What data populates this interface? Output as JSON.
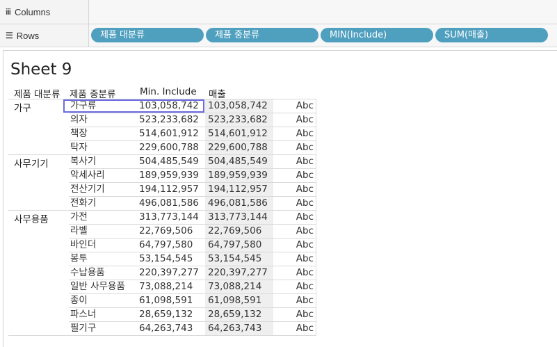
{
  "shelves": {
    "columns": {
      "label": "Columns",
      "icon": "iii"
    },
    "rows": {
      "label": "Rows",
      "icon": "☰",
      "pills": [
        "제품 대분류",
        "제품 중분류",
        "MIN(Include)",
        "SUM(매출)"
      ]
    }
  },
  "sheet": {
    "title": "Sheet 9",
    "headers": {
      "category": "제품 대분류",
      "subcategory": "제품 중분류",
      "min_include": "Min. Include",
      "sales": "매출"
    },
    "categories": [
      "가구",
      "사무기기",
      "사무용품"
    ],
    "rows": [
      {
        "sub": "가구류",
        "min": "103,058,742",
        "sales": "103,058,742",
        "abc": "Abc"
      },
      {
        "sub": "의자",
        "min": "523,233,682",
        "sales": "523,233,682",
        "abc": "Abc"
      },
      {
        "sub": "책장",
        "min": "514,601,912",
        "sales": "514,601,912",
        "abc": "Abc"
      },
      {
        "sub": "탁자",
        "min": "229,600,788",
        "sales": "229,600,788",
        "abc": "Abc"
      },
      {
        "sub": "복사기",
        "min": "504,485,549",
        "sales": "504,485,549",
        "abc": "Abc"
      },
      {
        "sub": "악세사리",
        "min": "189,959,939",
        "sales": "189,959,939",
        "abc": "Abc"
      },
      {
        "sub": "전산기기",
        "min": "194,112,957",
        "sales": "194,112,957",
        "abc": "Abc"
      },
      {
        "sub": "전화기",
        "min": "496,081,586",
        "sales": "496,081,586",
        "abc": "Abc"
      },
      {
        "sub": "가전",
        "min": "313,773,144",
        "sales": "313,773,144",
        "abc": "Abc"
      },
      {
        "sub": "라벨",
        "min": "22,769,506",
        "sales": "22,769,506",
        "abc": "Abc"
      },
      {
        "sub": "바인더",
        "min": "64,797,580",
        "sales": "64,797,580",
        "abc": "Abc"
      },
      {
        "sub": "봉투",
        "min": "53,154,545",
        "sales": "53,154,545",
        "abc": "Abc"
      },
      {
        "sub": "수납용품",
        "min": "220,397,277",
        "sales": "220,397,277",
        "abc": "Abc"
      },
      {
        "sub": "일반 사무용품",
        "min": "73,088,214",
        "sales": "73,088,214",
        "abc": "Abc"
      },
      {
        "sub": "종이",
        "min": "61,098,591",
        "sales": "61,098,591",
        "abc": "Abc"
      },
      {
        "sub": "파스너",
        "min": "28,659,132",
        "sales": "28,659,132",
        "abc": "Abc"
      },
      {
        "sub": "필기구",
        "min": "64,263,743",
        "sales": "64,263,743",
        "abc": "Abc"
      }
    ]
  },
  "colors": {
    "pill": "#4f9fbf",
    "selection": "#6a6ade",
    "shelf_bg": "#f4f4f4"
  }
}
